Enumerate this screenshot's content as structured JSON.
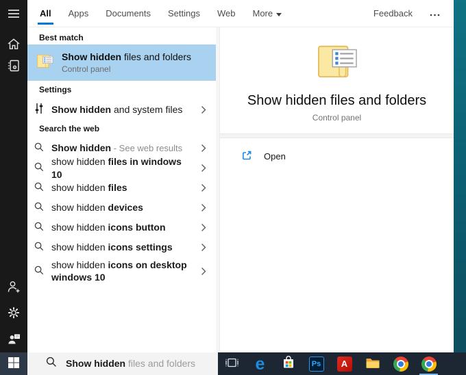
{
  "tabbar": {
    "tabs": [
      {
        "label": "All",
        "active": true
      },
      {
        "label": "Apps",
        "active": false
      },
      {
        "label": "Documents",
        "active": false
      },
      {
        "label": "Settings",
        "active": false
      },
      {
        "label": "Web",
        "active": false
      },
      {
        "label": "More",
        "active": false,
        "has_dropdown": true
      }
    ],
    "feedback_label": "Feedback"
  },
  "sidebar": {
    "icons": [
      "menu",
      "home",
      "notebook",
      "add-person",
      "settings-gear",
      "account-picture"
    ]
  },
  "best_match": {
    "header": "Best match",
    "item": {
      "title_bold": "Show hidden",
      "title_rest": " files and folders",
      "subtitle": "Control panel",
      "icon": "folder-options-icon"
    }
  },
  "settings_section": {
    "header": "Settings",
    "item": {
      "lead_bold": "Show hidden",
      "rest": " and system files",
      "icon": "sliders-icon"
    }
  },
  "web_section": {
    "header": "Search the web",
    "rows": [
      {
        "lead": "Show hidden",
        "tail": " - See web results"
      },
      {
        "lead": "show hidden",
        "tail": " files in windows 10"
      },
      {
        "lead": "show hidden",
        "tail": " files"
      },
      {
        "lead": "show hidden",
        "tail": " devices"
      },
      {
        "lead": "show hidden",
        "tail": " icons button"
      },
      {
        "lead": "show hidden",
        "tail": " icons settings"
      },
      {
        "lead": "show hidden",
        "tail": " icons on desktop windows 10"
      }
    ]
  },
  "preview": {
    "title": "Show hidden files and folders",
    "subtitle": "Control panel",
    "open_label": "Open",
    "icon": "folder-options-icon"
  },
  "search_bar": {
    "typed": "Show hidden",
    "suggestion": " files and folders"
  },
  "taskbar": {
    "icons": [
      "start",
      "task-view",
      "edge",
      "microsoft-store",
      "photoshop",
      "acrobat-reader",
      "file-explorer",
      "chrome",
      "chrome-active"
    ],
    "edge_glyph": "e",
    "ps_glyph": "Ps",
    "acrobat_glyph": "A"
  },
  "colors": {
    "accent": "#0078d7",
    "best_match_highlight": "#a9d2f0",
    "taskbar": "#1d2733",
    "sidebar": "#191919",
    "wallpaper_teal_top": "#0f7384",
    "wallpaper_teal_bottom": "#0d4d5f",
    "active_app_underline": "#76b9f0"
  }
}
